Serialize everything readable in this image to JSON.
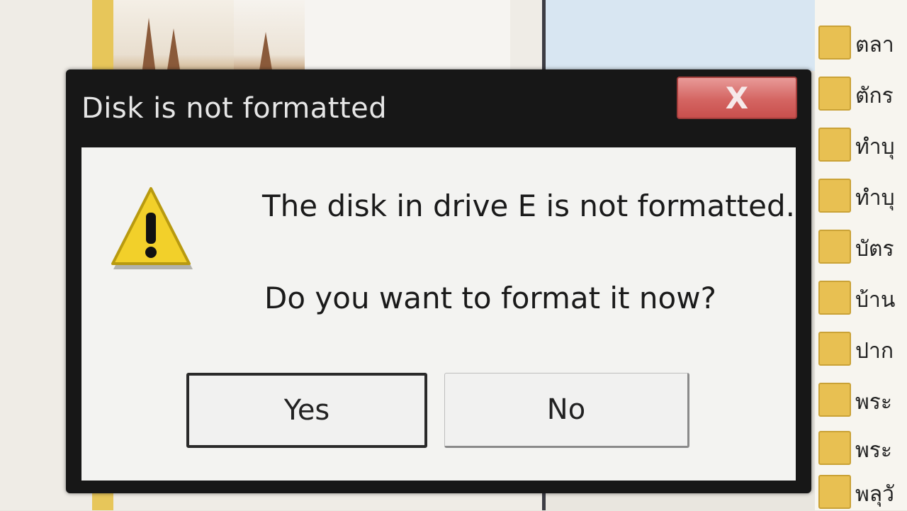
{
  "dialog": {
    "title": "Disk is not formatted",
    "close_label": "X",
    "message_line1": "The disk in drive E is not formatted.",
    "message_line2": "Do you want to format it now?",
    "yes_label": "Yes",
    "no_label": "No",
    "icon": "warning-icon"
  },
  "background": {
    "folders": [
      "ตลา",
      "ตักร",
      "ทำบุ",
      "ทำบุ",
      "บัตร",
      "บ้าน",
      "ปาก",
      "พระ",
      "พระ",
      "พลุวั"
    ]
  },
  "colors": {
    "titlebar": "#171717",
    "close_button": "#d46562",
    "warning_yellow": "#f2d02a",
    "dialog_body": "#f3f3f1"
  }
}
